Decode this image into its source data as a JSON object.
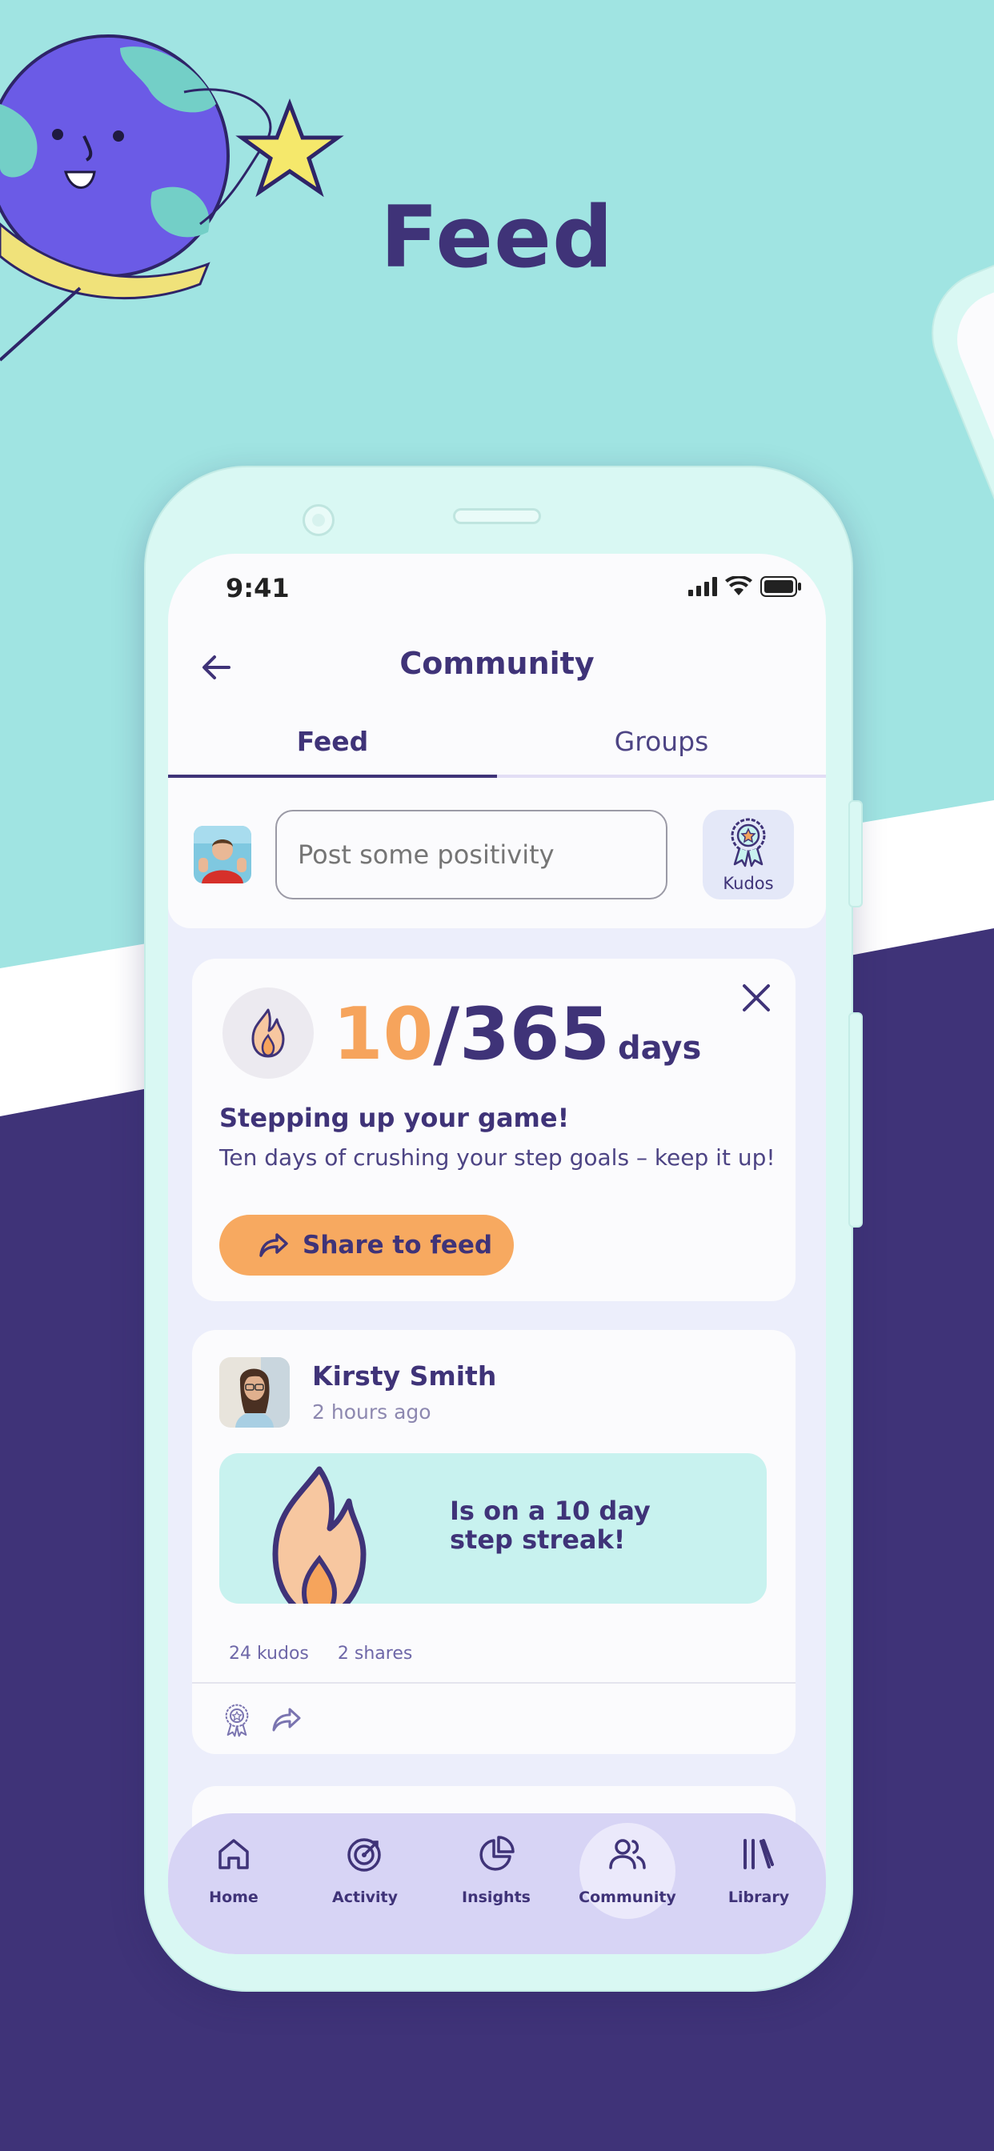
{
  "headline": "Feed",
  "colors": {
    "teal_bg": "#a0e4e2",
    "purple_bg": "#3f3378",
    "accent_orange": "#f6a45c",
    "white_band": "#ffffff"
  },
  "status_bar": {
    "time": "9:41",
    "icons": [
      "signal-icon",
      "wifi-icon",
      "battery-icon"
    ]
  },
  "header": {
    "title": "Community",
    "back_icon": "arrow-left-icon"
  },
  "tabs": [
    {
      "label": "Feed",
      "active": true
    },
    {
      "label": "Groups",
      "active": false
    }
  ],
  "composer": {
    "placeholder": "Post some positivity",
    "kudos_label": "Kudos"
  },
  "streak_card": {
    "current": "10",
    "total": "/365",
    "unit": "days",
    "title": "Stepping up your game!",
    "description": "Ten days of crushing your step goals – keep it up!",
    "share_label": "Share to feed"
  },
  "post": {
    "author": "Kirsty Smith",
    "time": "2 hours ago",
    "message": "Is on a 10 day step streak!",
    "kudos": "24 kudos",
    "shares": "2 shares"
  },
  "bottom_nav": [
    {
      "label": "Home",
      "icon": "home-icon",
      "active": false
    },
    {
      "label": "Activity",
      "icon": "target-icon",
      "active": false
    },
    {
      "label": "Insights",
      "icon": "pie-chart-icon",
      "active": false
    },
    {
      "label": "Community",
      "icon": "users-icon",
      "active": true
    },
    {
      "label": "Library",
      "icon": "library-icon",
      "active": false
    }
  ]
}
